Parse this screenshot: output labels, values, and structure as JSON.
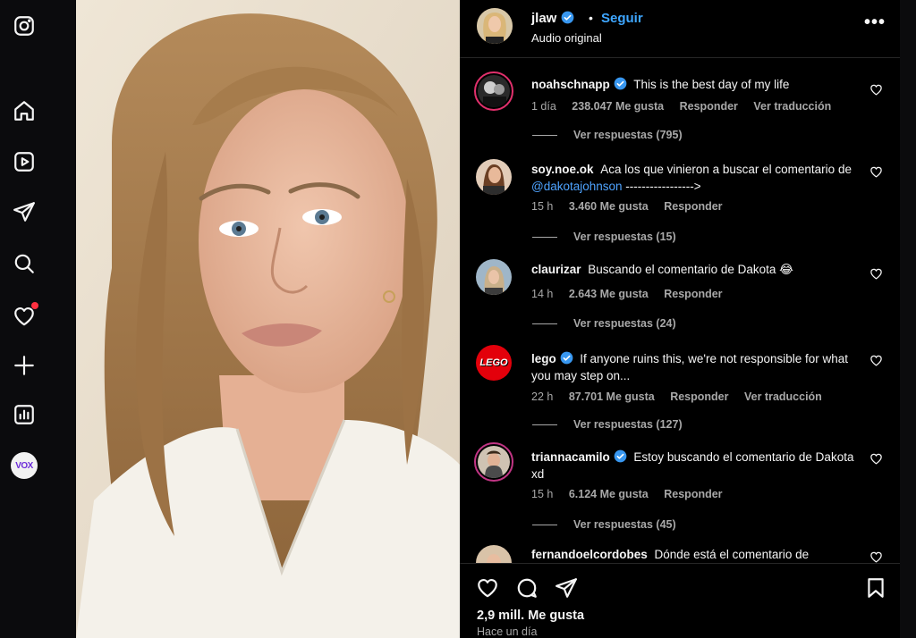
{
  "nav": {
    "items": [
      "instagram-logo",
      "home",
      "reels",
      "messages",
      "search",
      "notifications",
      "create",
      "insights",
      "profile-vox"
    ],
    "profile_label": "VOX"
  },
  "post": {
    "author": "jlaw",
    "separator": "•",
    "follow_label": "Seguir",
    "audio": "Audio original",
    "more": "•••"
  },
  "comments": [
    {
      "user": "noahschnapp",
      "verified": true,
      "text": "This is the best day of my life",
      "time": "1 día",
      "likes": "238.047 Me gusta",
      "reply": "Responder",
      "translate": "Ver traducción",
      "replies": "Ver respuestas (795)"
    },
    {
      "user": "soy.noe.ok",
      "verified": false,
      "text_before": "Aca los que vinieron a buscar el comentario de",
      "mention": "@dakotajohnson",
      "text_after": "----------------->",
      "time": "15 h",
      "likes": "3.460 Me gusta",
      "reply": "Responder",
      "replies": "Ver respuestas (15)"
    },
    {
      "user": "claurizar",
      "verified": false,
      "text": "Buscando el comentario de Dakota 😂",
      "time": "14 h",
      "likes": "2.643 Me gusta",
      "reply": "Responder",
      "replies": "Ver respuestas (24)"
    },
    {
      "user": "lego",
      "verified": true,
      "text": "If anyone ruins this,  we're not responsible for what you may step on...",
      "time": "22 h",
      "likes": "87.701 Me gusta",
      "reply": "Responder",
      "translate": "Ver traducción",
      "replies": "Ver respuestas (127)",
      "avatar_label": "LEGO"
    },
    {
      "user": "triannacamilo",
      "verified": true,
      "text": "Estoy buscando el comentario de Dakota xd",
      "time": "15 h",
      "likes": "6.124 Me gusta",
      "reply": "Responder",
      "replies": "Ver respuestas (45)"
    },
    {
      "user": "fernandoelcordobes",
      "verified": false,
      "text": "Dónde está el comentario de"
    }
  ],
  "footer": {
    "likes": "2,9 mill. Me gusta",
    "time": "Hace un día"
  },
  "colors": {
    "accent": "#3ea6ff",
    "verified": "#3897f0",
    "background": "#000000",
    "secondary_text": "#a8a8a8",
    "notification": "#ff3040"
  }
}
